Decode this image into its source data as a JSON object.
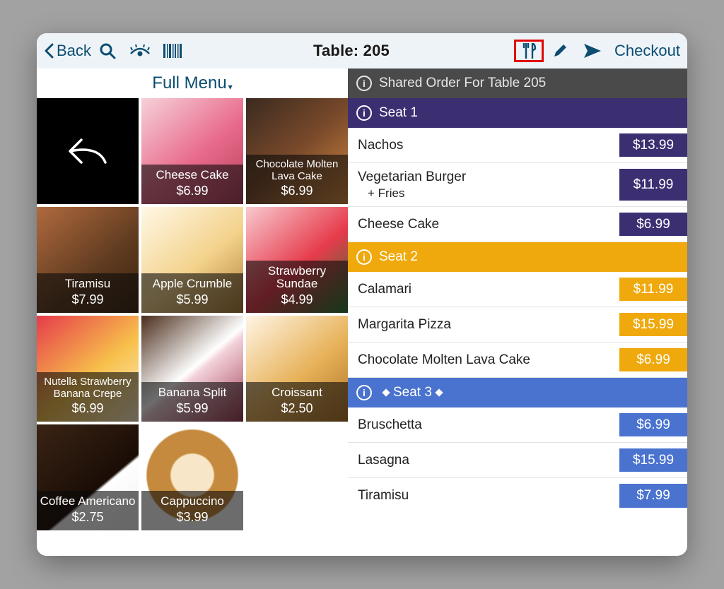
{
  "topbar": {
    "back_label": "Back",
    "title": "Table: 205",
    "checkout_label": "Checkout"
  },
  "menu": {
    "header": "Full Menu",
    "items": [
      {
        "name": "Cheese Cake",
        "price": "$6.99"
      },
      {
        "name": "Chocolate Molten Lava Cake",
        "price": "$6.99"
      },
      {
        "name": "Tiramisu",
        "price": "$7.99"
      },
      {
        "name": "Apple Crumble",
        "price": "$5.99"
      },
      {
        "name": "Strawberry Sundae",
        "price": "$4.99"
      },
      {
        "name": "Nutella Strawberry Banana Crepe",
        "price": "$6.99"
      },
      {
        "name": "Banana Split",
        "price": "$5.99"
      },
      {
        "name": "Croissant",
        "price": "$2.50"
      },
      {
        "name": "Coffee Americano",
        "price": "$2.75"
      },
      {
        "name": "Cappuccino",
        "price": "$3.99"
      }
    ]
  },
  "order": {
    "header": "Shared Order For Table 205",
    "seats": [
      {
        "label": "Seat 1",
        "items": [
          {
            "name": "Nachos",
            "mods": "",
            "price": "$13.99"
          },
          {
            "name": "Vegetarian Burger",
            "mods": "+ Fries",
            "price": "$11.99"
          },
          {
            "name": "Cheese Cake",
            "mods": "",
            "price": "$6.99"
          }
        ]
      },
      {
        "label": "Seat 2",
        "items": [
          {
            "name": "Calamari",
            "mods": "",
            "price": "$11.99"
          },
          {
            "name": "Margarita Pizza",
            "mods": "",
            "price": "$15.99"
          },
          {
            "name": "Chocolate Molten Lava Cake",
            "mods": "",
            "price": "$6.99"
          }
        ]
      },
      {
        "label": "Seat 3",
        "items": [
          {
            "name": "Bruschetta",
            "mods": "",
            "price": "$6.99"
          },
          {
            "name": "Lasagna",
            "mods": "",
            "price": "$15.99"
          },
          {
            "name": "Tiramisu",
            "mods": "",
            "price": "$7.99"
          }
        ]
      }
    ]
  }
}
